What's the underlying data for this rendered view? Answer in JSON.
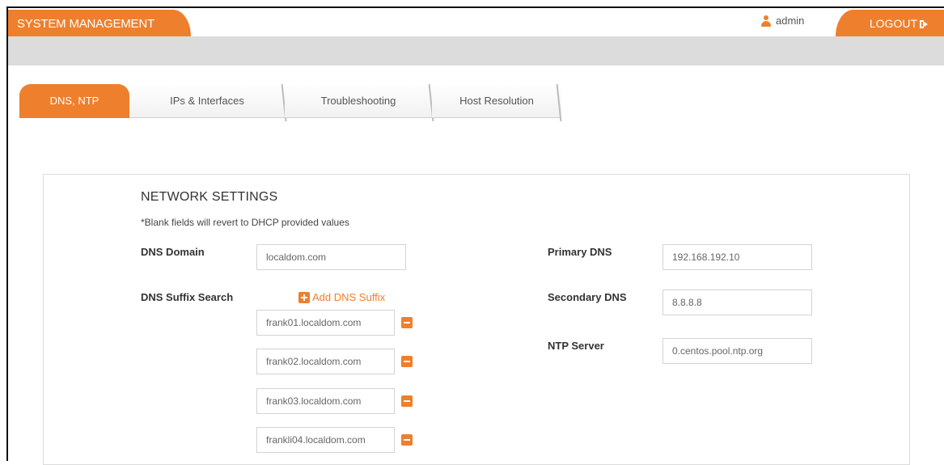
{
  "header": {
    "app_title": "SYSTEM MANAGEMENT",
    "username": "admin",
    "logout_label": "LOGOUT",
    "accent_color": "#ee7f2d"
  },
  "tabs": [
    {
      "label": "DNS, NTP",
      "active": true
    },
    {
      "label": "IPs & Interfaces",
      "active": false
    },
    {
      "label": "Troubleshooting",
      "active": false
    },
    {
      "label": "Host Resolution",
      "active": false
    }
  ],
  "network": {
    "title": "NETWORK SETTINGS",
    "note": "*Blank fields will revert to DHCP provided values",
    "dns_domain_label": "DNS Domain",
    "dns_domain_value": "localdom.com",
    "dns_suffix_label": "DNS Suffix Search",
    "add_suffix_label": "Add DNS Suffix",
    "suffixes": [
      "frank01.localdom.com",
      "frank02.localdom.com",
      "frank03.localdom.com",
      "frankli04.localdom.com"
    ],
    "primary_dns_label": "Primary DNS",
    "primary_dns_value": "192.168.192.10",
    "secondary_dns_label": "Secondary DNS",
    "secondary_dns_value": "8.8.8.8",
    "ntp_label": "NTP Server",
    "ntp_value": "0.centos.pool.ntp.org"
  },
  "icons": {
    "user": "user-icon",
    "logout": "sign-out-icon",
    "add": "plus-square-icon",
    "remove": "minus-square-icon"
  }
}
